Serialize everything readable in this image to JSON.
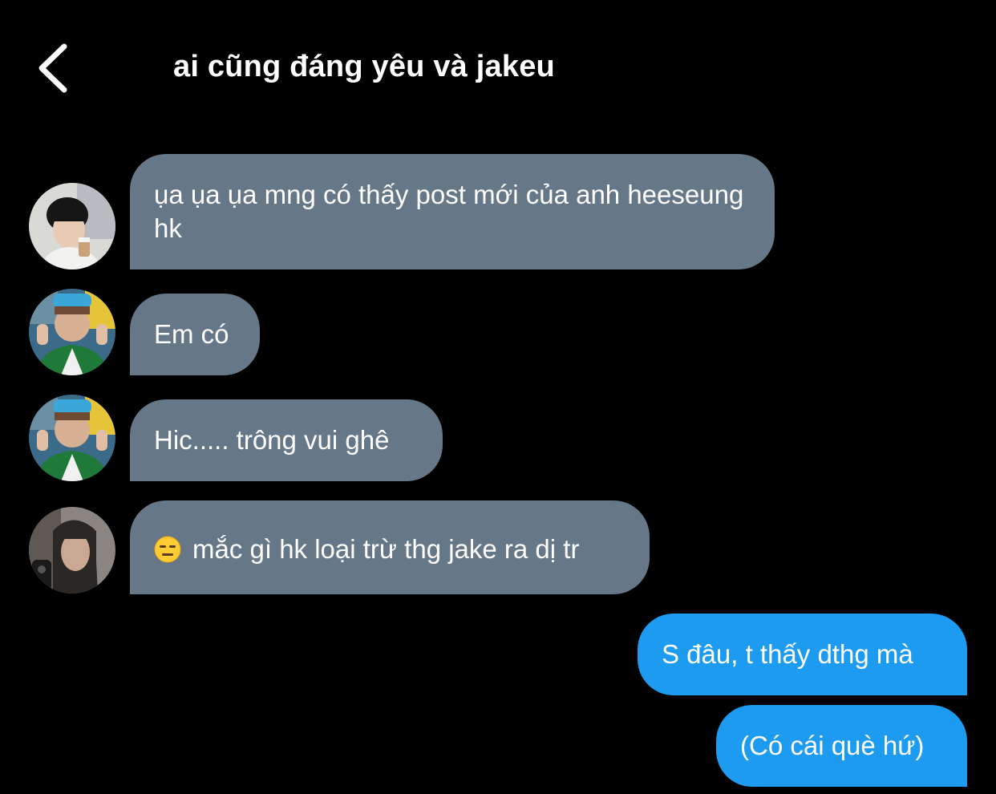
{
  "header": {
    "back_icon": "chevron-left-icon",
    "title": "ai cũng đáng yêu và jakeu"
  },
  "colors": {
    "background": "#000000",
    "incoming_bubble": "#667788",
    "outgoing_bubble": "#1D9BF0",
    "text": "#FFFFFF"
  },
  "messages": [
    {
      "direction": "incoming",
      "text": "ụa ụa ụa mng có thấy post mới của anh heeseung hk"
    },
    {
      "direction": "incoming",
      "text": "Em có"
    },
    {
      "direction": "incoming",
      "text": "Hic..... trông vui ghê"
    },
    {
      "direction": "incoming",
      "emoji": "expressionless-face-emoji",
      "text": "mắc gì hk loại trừ thg jake ra dị tr"
    },
    {
      "direction": "outgoing",
      "text": "S đâu, t thấy dthg mà"
    },
    {
      "direction": "outgoing",
      "text": "(Có cái què hứ)"
    }
  ]
}
